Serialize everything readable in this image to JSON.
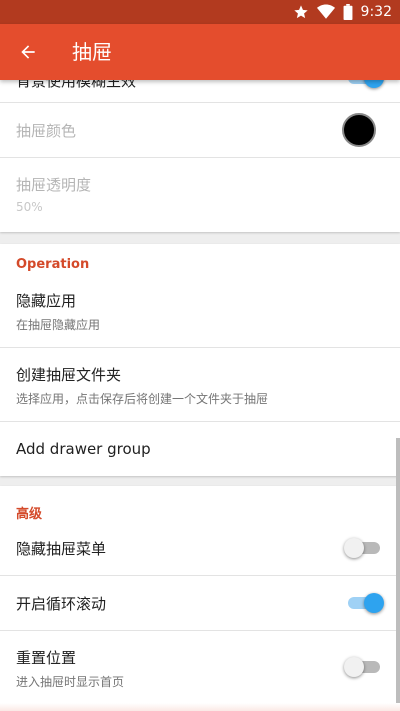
{
  "status_bar": {
    "time": "9:32",
    "icons": [
      "star-icon",
      "wifi-icon",
      "battery-icon"
    ]
  },
  "app_bar": {
    "title": "抽屉",
    "back_icon": "arrow-back-icon"
  },
  "colors": {
    "accent": "#e44d2d",
    "status_bar": "#b23a1f",
    "section_header": "#d44a2a",
    "switch_on": "#2ea3ef",
    "drawer_color": "#000000"
  },
  "sections": {
    "appearance": {
      "partial_item": {
        "title": "背景使用模糊生效",
        "enabled": true
      },
      "drawer_color": {
        "title": "抽屉颜色"
      },
      "drawer_opacity": {
        "title": "抽屉透明度",
        "summary": "50%"
      }
    },
    "operation": {
      "header": "Operation",
      "hide_apps": {
        "title": "隐藏应用",
        "summary": "在抽屉隐藏应用"
      },
      "create_folder": {
        "title": "创建抽屉文件夹",
        "summary": "选择应用，点击保存后将创建一个文件夹于抽屉"
      },
      "add_group": {
        "title": "Add drawer group"
      }
    },
    "advanced": {
      "header": "高级",
      "hide_menu": {
        "title": "隐藏抽屉菜单",
        "enabled": false
      },
      "loop_scroll": {
        "title": "开启循环滚动",
        "enabled": true
      },
      "reset_position": {
        "title": "重置位置",
        "summary": "进入抽屉时显示首页",
        "enabled": false
      }
    }
  }
}
